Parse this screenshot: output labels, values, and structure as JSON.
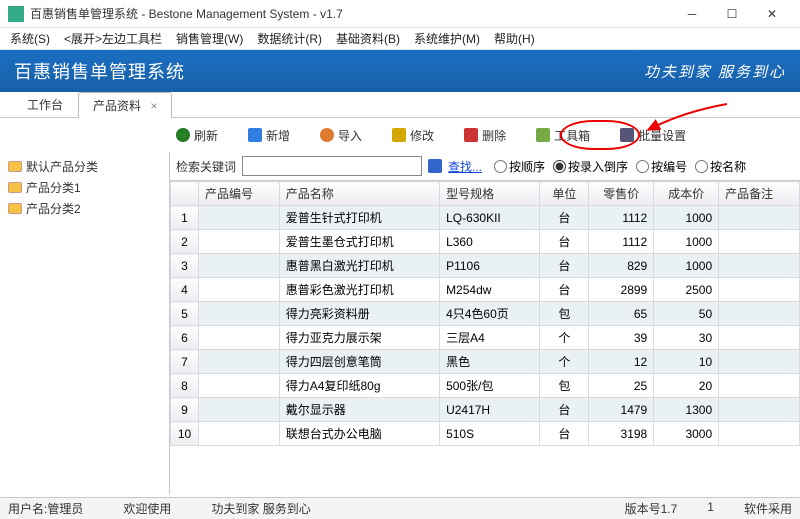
{
  "window": {
    "title": "百惠销售单管理系统 - Bestone Management System - v1.7"
  },
  "menu": {
    "items": [
      "系统(S)",
      "<展开>左边工具栏",
      "销售管理(W)",
      "数据统计(R)",
      "基础资料(B)",
      "系统维护(M)",
      "帮助(H)"
    ]
  },
  "banner": {
    "brand": "百惠销售单管理系统",
    "slogan": "功夫到家 服务到心"
  },
  "tabs": [
    {
      "label": "工作台",
      "active": false,
      "closable": false
    },
    {
      "label": "产品资料",
      "active": true,
      "closable": true
    }
  ],
  "toolbar": {
    "refresh": "刷新",
    "add": "新增",
    "import": "导入",
    "edit": "修改",
    "delete": "删除",
    "tools": "工具箱",
    "batch": "批量设置"
  },
  "tree": {
    "items": [
      "默认产品分类",
      "产品分类1",
      "产品分类2"
    ]
  },
  "search": {
    "label": "检索关键词",
    "value": "",
    "findBtn": "查找...",
    "radios": [
      {
        "label": "按顺序",
        "checked": false
      },
      {
        "label": "按录入倒序",
        "checked": true
      },
      {
        "label": "按编号",
        "checked": false
      },
      {
        "label": "按名称",
        "checked": false
      }
    ]
  },
  "table": {
    "headers": [
      "",
      "产品编号",
      "产品名称",
      "型号规格",
      "单位",
      "零售价",
      "成本价",
      "产品备注"
    ],
    "rows": [
      {
        "n": 1,
        "code": "",
        "name": "爱普生针式打印机",
        "spec": "LQ-630KII",
        "unit": "台",
        "price": 1112,
        "cost": 1000,
        "remark": ""
      },
      {
        "n": 2,
        "code": "",
        "name": "爱普生墨仓式打印机",
        "spec": "L360",
        "unit": "台",
        "price": 1112,
        "cost": 1000,
        "remark": ""
      },
      {
        "n": 3,
        "code": "",
        "name": "惠普黑白激光打印机",
        "spec": "P1106",
        "unit": "台",
        "price": 829,
        "cost": 1000,
        "remark": ""
      },
      {
        "n": 4,
        "code": "",
        "name": "惠普彩色激光打印机",
        "spec": "M254dw",
        "unit": "台",
        "price": 2899,
        "cost": 2500,
        "remark": ""
      },
      {
        "n": 5,
        "code": "",
        "name": "得力亮彩资料册",
        "spec": "4只4色60页",
        "unit": "包",
        "price": 65,
        "cost": 50,
        "remark": ""
      },
      {
        "n": 6,
        "code": "",
        "name": "得力亚克力展示架",
        "spec": "三层A4",
        "unit": "个",
        "price": 39,
        "cost": 30,
        "remark": ""
      },
      {
        "n": 7,
        "code": "",
        "name": "得力四层创意笔筒",
        "spec": "黑色",
        "unit": "个",
        "price": 12,
        "cost": 10,
        "remark": ""
      },
      {
        "n": 8,
        "code": "",
        "name": "得力A4复印纸80g",
        "spec": "500张/包",
        "unit": "包",
        "price": 25,
        "cost": 20,
        "remark": ""
      },
      {
        "n": 9,
        "code": "",
        "name": "戴尔显示器",
        "spec": "U2417H",
        "unit": "台",
        "price": 1479,
        "cost": 1300,
        "remark": ""
      },
      {
        "n": 10,
        "code": "",
        "name": "联想台式办公电脑",
        "spec": "510S",
        "unit": "台",
        "price": 3198,
        "cost": 3000,
        "remark": ""
      }
    ]
  },
  "status": {
    "user": "用户名:管理员",
    "welcome": "欢迎使用",
    "slogan": "功夫到家 服务到心",
    "version": "版本号1.7",
    "count": "1",
    "countLbl": "软件采用"
  }
}
